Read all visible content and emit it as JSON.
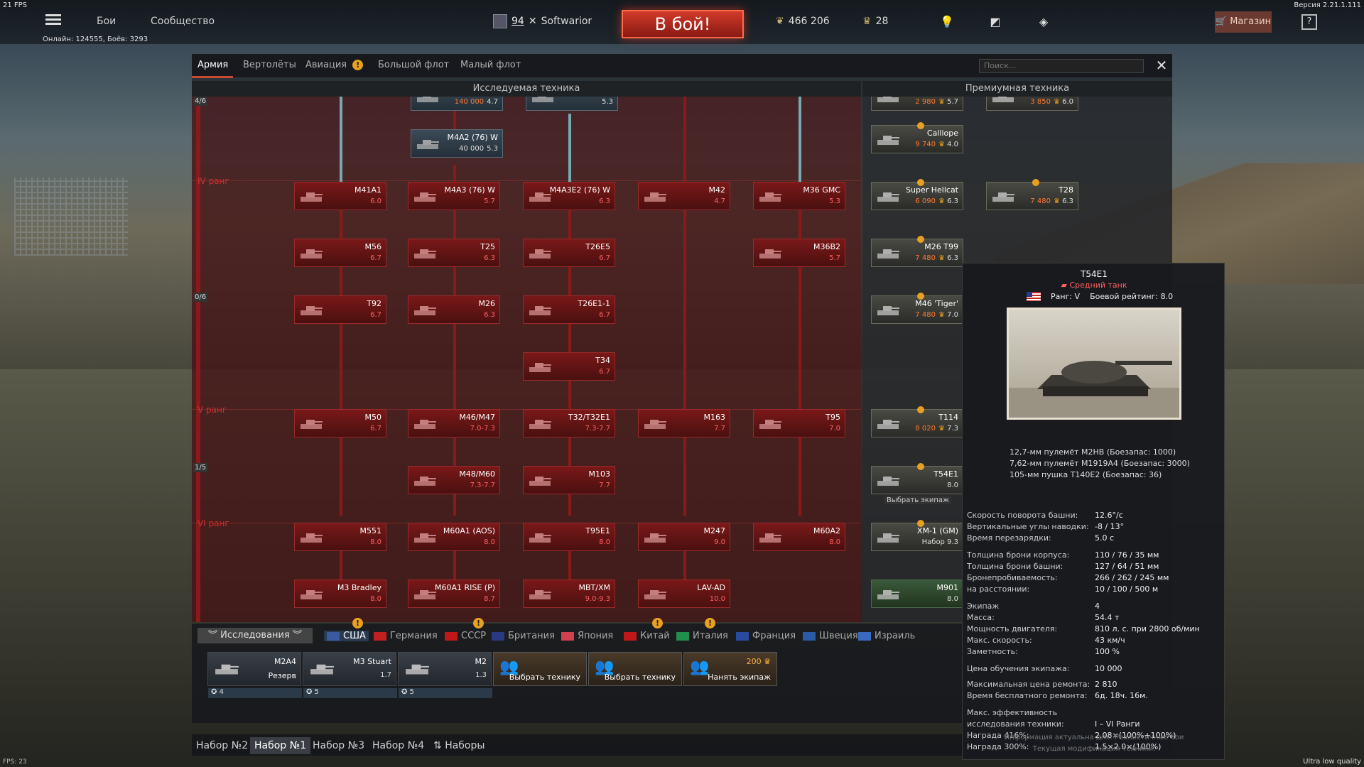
{
  "hud": {
    "fps_top": "21 FPS",
    "version": "Версия 2.21.1.111",
    "online": "Онлайн: 124555, Боёв: 3293",
    "fps_bottom": "FPS: 23",
    "quality": "Ultra low quality"
  },
  "topbar": {
    "nav_battles": "Бои",
    "nav_community": "Сообщество",
    "player_level": "94",
    "player_name": "Softwarior",
    "battle_button": "В бой!",
    "silver_lions": "466 206",
    "golden_eagles": "28",
    "shop": "Магазин",
    "help": "?"
  },
  "tree": {
    "tabs": [
      {
        "label": "Армия",
        "active": true
      },
      {
        "label": "Вертолёты"
      },
      {
        "label": "Авиация",
        "warning": "!"
      },
      {
        "label": "Большой флот"
      },
      {
        "label": "Малый флот"
      }
    ],
    "search_placeholder": "Поиск...",
    "section_research": "Исследуемая техника",
    "section_premium": "Премиумная техника",
    "rank_labels": [
      "IV ранг",
      "V ранг",
      "VI ранг"
    ],
    "count_labels": [
      "4/6",
      "0/6",
      "1/5"
    ],
    "research_vehicles": [
      {
        "name": "",
        "price": "140 000",
        "br": "4.7"
      },
      {
        "name": "",
        "br": "5.3"
      },
      {
        "name": "M4A2 (76) W",
        "price": "40 000",
        "br": "5.3"
      },
      {
        "name": "M41A1",
        "br": "6.0"
      },
      {
        "name": "M4A3 (76) W",
        "br": "5.7"
      },
      {
        "name": "M4A3E2 (76) W",
        "br": "6.3"
      },
      {
        "name": "M42",
        "br": "4.7"
      },
      {
        "name": "M36 GMC",
        "br": "5.3"
      },
      {
        "name": "M56",
        "br": "6.7"
      },
      {
        "name": "T25",
        "br": "6.3"
      },
      {
        "name": "T26E5",
        "br": "6.7"
      },
      {
        "name": "M36B2",
        "br": "5.7"
      },
      {
        "name": "T92",
        "br": "6.7"
      },
      {
        "name": "M26",
        "br": "6.3"
      },
      {
        "name": "T26E1-1",
        "br": "6.7"
      },
      {
        "name": "T34",
        "br": "6.7"
      },
      {
        "name": "M50",
        "br": "6.7"
      },
      {
        "name": "M46/M47",
        "br": "7.0-7.3"
      },
      {
        "name": "T32/T32E1",
        "br": "7.3-7.7"
      },
      {
        "name": "M163",
        "br": "7.7"
      },
      {
        "name": "T95",
        "br": "7.0"
      },
      {
        "name": "M48/M60",
        "br": "7.3-7.7"
      },
      {
        "name": "M103",
        "br": "7.7"
      },
      {
        "name": "M551",
        "br": "8.0"
      },
      {
        "name": "M60A1 (AOS)",
        "br": "8.0"
      },
      {
        "name": "T95E1",
        "br": "8.0"
      },
      {
        "name": "M247",
        "br": "9.0"
      },
      {
        "name": "M60A2",
        "br": "8.0"
      },
      {
        "name": "M3 Bradley",
        "br": "8.0"
      },
      {
        "name": "M60A1 RISE (P)",
        "br": "8.7"
      },
      {
        "name": "MBT/XM",
        "br": "9.0-9.3"
      },
      {
        "name": "LAV-AD",
        "br": "10.0"
      }
    ],
    "premium_vehicles": [
      {
        "name": "",
        "price": "2 980",
        "br": "5.7"
      },
      {
        "name": "",
        "price": "3 850",
        "br": "6.0"
      },
      {
        "name": "Calliope",
        "price": "9 740",
        "br": "4.0"
      },
      {
        "name": "Super Hellcat",
        "price": "6 090",
        "br": "6.3"
      },
      {
        "name": "T28",
        "price": "7 480",
        "br": "6.3"
      },
      {
        "name": "M26 T99",
        "price": "7 480",
        "br": "6.3"
      },
      {
        "name": "M46 'Tiger'",
        "price": "7 480",
        "br": "7.0"
      },
      {
        "name": "T114",
        "price": "8 020",
        "br": "7.3"
      },
      {
        "name": "T54E1",
        "br": "8.0",
        "hover": "Выбрать экипаж"
      },
      {
        "name": "XM-1 (GM)",
        "br": "Набор 9.3"
      },
      {
        "name": "M901",
        "br": "8.0"
      }
    ]
  },
  "bottom": {
    "research_label": "Исследования",
    "nations": [
      {
        "label": "США",
        "active": true,
        "warning": "!",
        "color": "#3a5aa0"
      },
      {
        "label": "Германия",
        "color": "#c02020"
      },
      {
        "label": "СССР",
        "warning": "!",
        "color": "#c01818"
      },
      {
        "label": "Британия",
        "color": "#2a3a80"
      },
      {
        "label": "Япония",
        "color": "#d04050"
      },
      {
        "label": "Китай",
        "warning": "!",
        "color": "#c01818"
      },
      {
        "label": "Италия",
        "warning": "!",
        "color": "#20904a"
      },
      {
        "label": "Франция",
        "color": "#2a4aa0"
      },
      {
        "label": "Швеция",
        "color": "#2a5aa8"
      },
      {
        "label": "Израиль",
        "color": "#3a6ac0"
      }
    ],
    "slots": [
      {
        "name": "M2A4",
        "sub": "Резерв",
        "crew": "4"
      },
      {
        "name": "M3 Stuart",
        "br": "1.7",
        "crew": "5"
      },
      {
        "name": "M2",
        "br": "1.3",
        "crew": "5"
      }
    ],
    "actions": [
      {
        "label": "Выбрать технику"
      },
      {
        "label": "Выбрать технику"
      },
      {
        "label": "Нанять экипаж",
        "price": "200"
      }
    ],
    "presets": [
      "Набор №2",
      "Набор №1",
      "Набор №3",
      "Набор №4",
      "Наборы"
    ],
    "active_preset": "Набор №1"
  },
  "tooltip": {
    "name": "T54E1",
    "class": "Средний танк",
    "rank": "Ранг: V",
    "br": "Боевой рейтинг: 8.0",
    "weapons": [
      "12,7-мм пулемёт M2HB (Боезапас: 1000)",
      "7,62-мм пулемёт M1919A4 (Боезапас: 3000)",
      "105-мм пушка T140E2 (Боезапас: 36)"
    ],
    "stats": [
      {
        "label": "Скорость поворота башни:",
        "value": "12.6°/с"
      },
      {
        "label": "Вертикальные углы наводки:",
        "value": "-8 / 13°"
      },
      {
        "label": "Время перезарядки:",
        "value": "5.0 с"
      },
      {
        "label": "Толщина брони корпуса:",
        "value": "110 / 76 / 35 мм"
      },
      {
        "label": "Толщина брони башни:",
        "value": "127 / 64 / 51 мм"
      },
      {
        "label": "Бронепробиваемость:",
        "value": "266 / 262 / 245 мм"
      },
      {
        "label": "на расстоянии:",
        "value": "10 / 100 / 500 м"
      },
      {
        "label": "Экипаж",
        "value": "4"
      },
      {
        "label": "Масса:",
        "value": "54.4 т"
      },
      {
        "label": "Мощность двигателя:",
        "value": "810 л. с. при 2800 об/мин"
      },
      {
        "label": "Макс. скорость:",
        "value": "43 км/ч"
      },
      {
        "label": "Заметность:",
        "value": "100 %"
      },
      {
        "label": "Цена обучения экипажа:",
        "value": "10 000"
      },
      {
        "label": "Максимальная цена ремонта:",
        "value": "2 810"
      },
      {
        "label": "Время бесплатного ремонта:",
        "value": "6д. 18ч. 16м."
      },
      {
        "label": "Макс. эффективность",
        "value": ""
      },
      {
        "label": "исследования техники:",
        "value": "I – VI Ранги"
      },
      {
        "label": "Награда 416%:",
        "value": "2.08×(100%+100%)"
      },
      {
        "label": "Награда 300%:",
        "value": "1.5×2.0×(100%)"
      }
    ],
    "footnote": [
      "Информация актуальна для: Реалистичные бои",
      "Текущая модификация техники."
    ]
  }
}
